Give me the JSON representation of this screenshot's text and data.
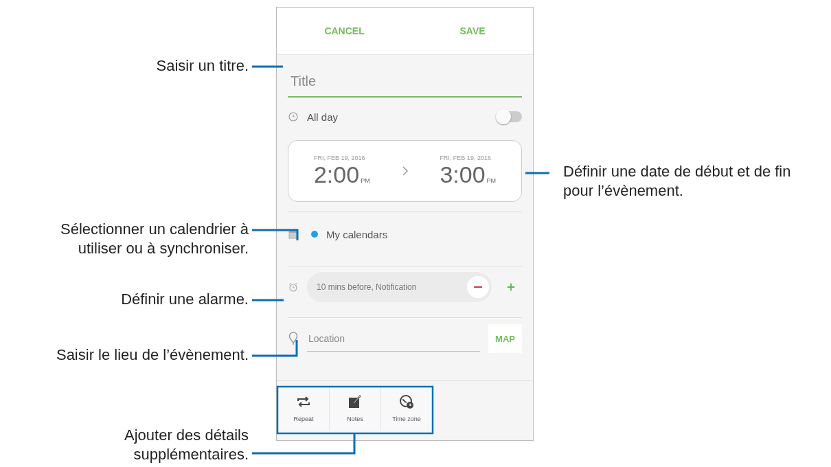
{
  "actions": [
    {
      "label": "CANCEL"
    },
    {
      "label": "SAVE"
    }
  ],
  "title_field": {
    "placeholder": "Title"
  },
  "all_day": {
    "label": "All day",
    "on": false
  },
  "start": {
    "date": "FRI, FEB 19, 2016",
    "time": "2:00",
    "meridiem": "PM"
  },
  "end": {
    "date": "FRI, FEB 19, 2016",
    "time": "3:00",
    "meridiem": "PM"
  },
  "calendar": {
    "name": "My calendars"
  },
  "alarm": {
    "text": "10 mins before, Notification"
  },
  "location": {
    "placeholder": "Location",
    "map_button": "MAP"
  },
  "options": [
    {
      "label": "Repeat",
      "kind": "repeat"
    },
    {
      "label": "Notes",
      "kind": "notes"
    },
    {
      "label": "Time zone",
      "kind": "timezone"
    }
  ],
  "callouts": [
    {
      "text": "Saisir un titre."
    },
    {
      "text": "Définir une date de début et de fin pour l’évènement."
    },
    {
      "text": "Sélectionner un calendrier à utiliser ou à synchroniser."
    },
    {
      "text": "Définir une alarme."
    },
    {
      "text": "Saisir le lieu de l’évènement."
    },
    {
      "text": "Ajouter des détails supplémentaires."
    }
  ]
}
